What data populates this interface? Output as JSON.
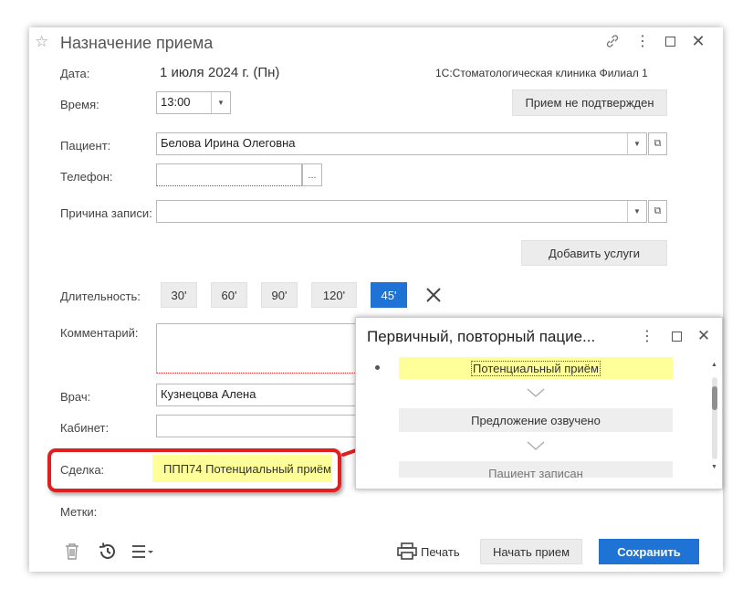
{
  "window": {
    "title": "Назначение приема"
  },
  "date": {
    "label": "Дата:",
    "value": "1 июля 2024 г. (Пн)",
    "org": "1С:Стоматологическая клиника Филиал 1"
  },
  "time": {
    "label": "Время:",
    "value": "13:00",
    "status_button": "Прием не подтвержден"
  },
  "patient": {
    "label": "Пациент:",
    "value": "Белова Ирина Олеговна"
  },
  "phone": {
    "label": "Телефон:",
    "value": "",
    "button": "..."
  },
  "reason": {
    "label": "Причина записи:",
    "value": ""
  },
  "services": {
    "add_button": "Добавить услуги"
  },
  "duration": {
    "label": "Длительность:",
    "options": [
      "30'",
      "60'",
      "90'",
      "120'",
      "45'"
    ],
    "selected": "45'"
  },
  "comment": {
    "label": "Комментарий:",
    "value": ""
  },
  "doctor": {
    "label": "Врач:",
    "value": "Кузнецова Алена"
  },
  "room": {
    "label": "Кабинет:",
    "value": ""
  },
  "deal": {
    "label": "Сделка:",
    "value": "ППП74  Потенциальный приём"
  },
  "tags": {
    "label": "Метки:"
  },
  "footer": {
    "print": "Печать",
    "start": "Начать прием",
    "save": "Сохранить"
  },
  "popup": {
    "title": "Первичный, повторный пацие...",
    "stages": [
      "Потенциальный приём",
      "Предложение озвучено",
      "Пациент записан"
    ]
  },
  "colors": {
    "accent": "#1f73d5",
    "highlight": "#ffff99",
    "callout": "#e02020"
  }
}
